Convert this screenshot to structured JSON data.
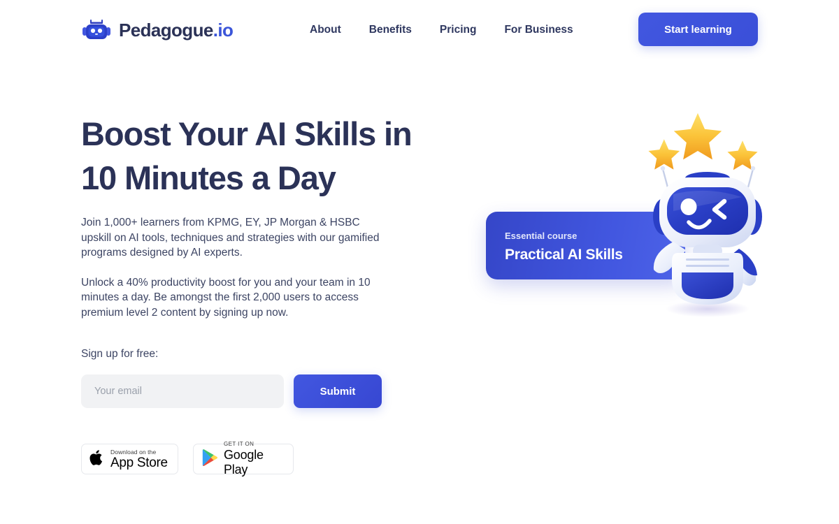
{
  "brand": {
    "name": "Pedagogue",
    "suffix": ".io",
    "logo_icon": "robot-head-icon",
    "accent_color": "#3b55d9",
    "heading_color": "#2b3257"
  },
  "header": {
    "nav": [
      {
        "label": "About"
      },
      {
        "label": "Benefits"
      },
      {
        "label": "Pricing"
      },
      {
        "label": "For Business"
      }
    ],
    "cta_label": "Start learning"
  },
  "hero": {
    "headline": "Boost Your AI Skills in\n10 Minutes a Day",
    "paragraph_1": "Join 1,000+ learners from KPMG, EY, JP Morgan & HSBC upskill on AI tools, techniques and strategies with our gamified programs designed by AI experts.",
    "paragraph_2": "Unlock a 40% productivity boost for you and your team in 10 minutes a day. Be amongst the first 2,000 users to access premium level 2 content by signing up now.",
    "signup_label": "Sign up for free:",
    "email_placeholder": "Your email",
    "email_value": "",
    "submit_label": "Submit"
  },
  "store_badges": [
    {
      "icon": "apple-logo-icon",
      "top_line": "Download on the",
      "bottom_line": "App Store"
    },
    {
      "icon": "google-play-icon",
      "top_line": "GET IT ON",
      "bottom_line": "Google Play"
    }
  ],
  "course_card": {
    "eyebrow": "Essential course",
    "title": "Practical AI Skills",
    "gradient_from": "#3546c8",
    "gradient_to": "#4d63e8"
  },
  "mascot": {
    "icon": "robot-mascot-illustration",
    "stars_count": 3,
    "star_color": "#f7b52c",
    "body_color": "#2440c0",
    "expression": "winking-smile"
  }
}
